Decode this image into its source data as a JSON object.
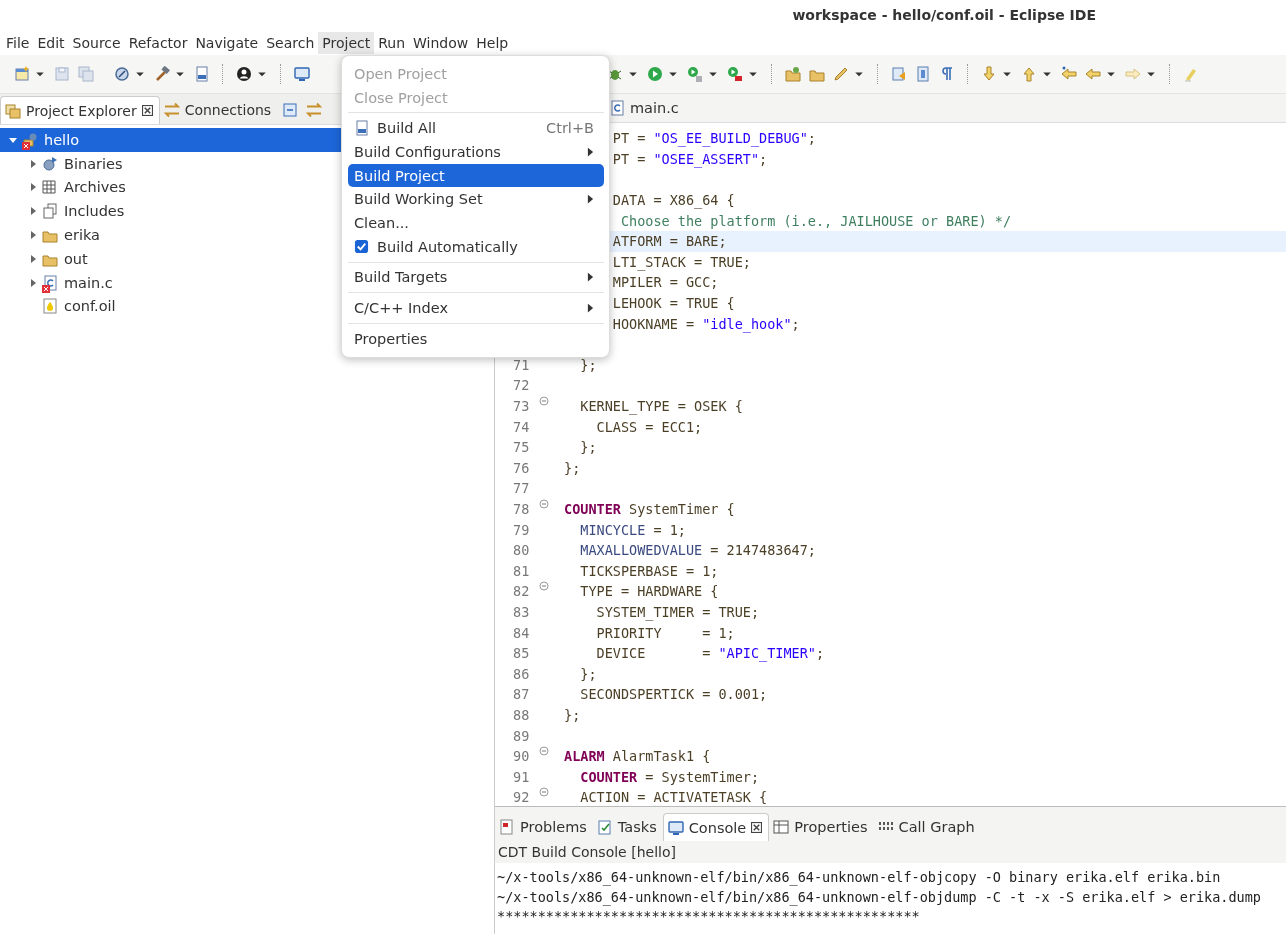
{
  "window": {
    "title": "workspace - hello/conf.oil - Eclipse IDE"
  },
  "menu_bar": [
    {
      "label": "File",
      "selected": false
    },
    {
      "label": "Edit",
      "selected": false
    },
    {
      "label": "Source",
      "selected": false
    },
    {
      "label": "Refactor",
      "selected": false
    },
    {
      "label": "Navigate",
      "selected": false
    },
    {
      "label": "Search",
      "selected": false
    },
    {
      "label": "Project",
      "selected": true
    },
    {
      "label": "Run",
      "selected": false
    },
    {
      "label": "Window",
      "selected": false
    },
    {
      "label": "Help",
      "selected": false
    }
  ],
  "project_menu": [
    {
      "kind": "item",
      "label": "Open Project",
      "disabled": true,
      "selected": false,
      "submenu": false
    },
    {
      "kind": "item",
      "label": "Close Project",
      "disabled": true,
      "selected": false,
      "submenu": false
    },
    {
      "kind": "separator"
    },
    {
      "kind": "icon-item",
      "label": "Build All",
      "shortcut": "Ctrl+B",
      "disabled": false,
      "selected": false,
      "submenu": false
    },
    {
      "kind": "item",
      "label": "Build Configurations",
      "disabled": false,
      "selected": false,
      "submenu": true
    },
    {
      "kind": "item",
      "label": "Build Project",
      "disabled": false,
      "selected": true,
      "submenu": false
    },
    {
      "kind": "item",
      "label": "Build Working Set",
      "disabled": false,
      "selected": false,
      "submenu": true
    },
    {
      "kind": "item",
      "label": "Clean...",
      "disabled": false,
      "selected": false,
      "submenu": false
    },
    {
      "kind": "check-item",
      "label": "Build Automatically",
      "checked": true,
      "disabled": false,
      "selected": false,
      "submenu": false
    },
    {
      "kind": "separator"
    },
    {
      "kind": "item",
      "label": "Build Targets",
      "disabled": false,
      "selected": false,
      "submenu": true
    },
    {
      "kind": "separator"
    },
    {
      "kind": "item",
      "label": "C/C++ Index",
      "disabled": false,
      "selected": false,
      "submenu": true
    },
    {
      "kind": "separator"
    },
    {
      "kind": "item",
      "label": "Properties",
      "disabled": false,
      "selected": false,
      "submenu": false
    }
  ],
  "left_panel": {
    "tabs": [
      {
        "label": "Project Explorer",
        "selected": true,
        "kind": "explorer"
      },
      {
        "label": "Connections",
        "selected": false,
        "kind": "connections"
      }
    ],
    "tree": [
      {
        "label": "hello",
        "kind": "project",
        "error": true,
        "expanded": true,
        "selected": true,
        "children": [
          {
            "label": "Binaries",
            "kind": "binaries",
            "error": false,
            "expanded": false,
            "selected": false
          },
          {
            "label": "Archives",
            "kind": "archives",
            "error": false,
            "expanded": false,
            "selected": false
          },
          {
            "label": "Includes",
            "kind": "includes",
            "error": false,
            "expanded": false,
            "selected": false
          },
          {
            "label": "erika",
            "kind": "folder",
            "error": false,
            "expanded": false,
            "selected": false
          },
          {
            "label": "out",
            "kind": "folder",
            "error": false,
            "expanded": false,
            "selected": false
          },
          {
            "label": "main.c",
            "kind": "c-file",
            "error": true,
            "expanded": false,
            "selected": false
          },
          {
            "label": "conf.oil",
            "kind": "oil-file",
            "error": false,
            "selected": false
          }
        ]
      }
    ]
  },
  "editor": {
    "tabs": [
      {
        "label": "main.c",
        "selected": false
      }
    ],
    "lines": [
      {
        "kind": "code",
        "parts": [
          {
            "kind": "plain",
            "text": "      PT = "
          },
          {
            "kind": "string",
            "text": "\"OS_EE_BUILD_DEBUG\""
          },
          {
            "kind": "plain",
            "text": ";"
          }
        ]
      },
      {
        "kind": "code",
        "parts": [
          {
            "kind": "plain",
            "text": "      PT = "
          },
          {
            "kind": "string",
            "text": "\"OSEE_ASSERT\""
          },
          {
            "kind": "plain",
            "text": ";"
          }
        ]
      },
      {
        "kind": "blank"
      },
      {
        "kind": "code",
        "parts": [
          {
            "kind": "plain",
            "text": "      DATA = X86_64 {"
          }
        ]
      },
      {
        "kind": "code",
        "parts": [
          {
            "kind": "comment",
            "text": "       Choose the platform (i.e., JAILHOUSE or BARE) */"
          }
        ]
      },
      {
        "kind": "code",
        "current": true,
        "parts": [
          {
            "kind": "plain",
            "text": "      ATFORM = BARE;"
          }
        ]
      },
      {
        "kind": "code",
        "parts": [
          {
            "kind": "plain",
            "text": "      LTI_STACK = TRUE;"
          }
        ]
      },
      {
        "kind": "code",
        "parts": [
          {
            "kind": "plain",
            "text": "      MPILER = GCC;"
          }
        ]
      },
      {
        "kind": "code",
        "parts": [
          {
            "kind": "plain",
            "text": "      LEHOOK = TRUE {"
          }
        ]
      },
      {
        "kind": "code",
        "parts": [
          {
            "kind": "plain",
            "text": "      HOOKNAME = "
          },
          {
            "kind": "string",
            "text": "\"idle_hook\""
          },
          {
            "kind": "plain",
            "text": ";"
          }
        ]
      },
      {
        "kind": "blank"
      },
      {
        "n": "71",
        "parts": [
          {
            "kind": "plain",
            "text": "  };"
          }
        ]
      },
      {
        "n": "72",
        "kind": "blank"
      },
      {
        "n": "73",
        "fold": true,
        "parts": [
          {
            "kind": "plain",
            "text": "  KERNEL_TYPE = OSEK {"
          }
        ]
      },
      {
        "n": "74",
        "parts": [
          {
            "kind": "plain",
            "text": "    CLASS = ECC1;"
          }
        ]
      },
      {
        "n": "75",
        "parts": [
          {
            "kind": "plain",
            "text": "  };"
          }
        ]
      },
      {
        "n": "76",
        "parts": [
          {
            "kind": "plain",
            "text": "};"
          }
        ]
      },
      {
        "n": "77",
        "kind": "blank"
      },
      {
        "n": "78",
        "fold": true,
        "parts": [
          {
            "kind": "keyword",
            "text": "COUNTER"
          },
          {
            "kind": "plain",
            "text": " SystemTimer {"
          }
        ]
      },
      {
        "n": "79",
        "parts": [
          {
            "kind": "attr",
            "text": "  MINCYCLE"
          },
          {
            "kind": "plain",
            "text": " = 1;"
          }
        ]
      },
      {
        "n": "80",
        "parts": [
          {
            "kind": "attr",
            "text": "  MAXALLOWEDVALUE"
          },
          {
            "kind": "plain",
            "text": " = 2147483647;"
          }
        ]
      },
      {
        "n": "81",
        "parts": [
          {
            "kind": "plain",
            "text": "  TICKSPERBASE = 1;"
          }
        ]
      },
      {
        "n": "82",
        "fold": true,
        "parts": [
          {
            "kind": "plain",
            "text": "  TYPE = HARDWARE {"
          }
        ]
      },
      {
        "n": "83",
        "parts": [
          {
            "kind": "plain",
            "text": "    SYSTEM_TIMER = TRUE;"
          }
        ]
      },
      {
        "n": "84",
        "parts": [
          {
            "kind": "plain",
            "text": "    PRIORITY     = 1;"
          }
        ]
      },
      {
        "n": "85",
        "parts": [
          {
            "kind": "plain",
            "text": "    DEVICE       = "
          },
          {
            "kind": "string",
            "text": "\"APIC_TIMER\""
          },
          {
            "kind": "plain",
            "text": ";"
          }
        ]
      },
      {
        "n": "86",
        "parts": [
          {
            "kind": "plain",
            "text": "  };"
          }
        ]
      },
      {
        "n": "87",
        "parts": [
          {
            "kind": "plain",
            "text": "  SECONDSPERTICK = 0.001;"
          }
        ]
      },
      {
        "n": "88",
        "parts": [
          {
            "kind": "plain",
            "text": "};"
          }
        ]
      },
      {
        "n": "89",
        "kind": "blank"
      },
      {
        "n": "90",
        "fold": true,
        "parts": [
          {
            "kind": "keyword",
            "text": "ALARM"
          },
          {
            "kind": "plain",
            "text": " AlarmTask1 {"
          }
        ]
      },
      {
        "n": "91",
        "parts": [
          {
            "kind": "keyword",
            "text": "  COUNTER"
          },
          {
            "kind": "plain",
            "text": " = SystemTimer;"
          }
        ]
      },
      {
        "n": "92",
        "fold": true,
        "parts": [
          {
            "kind": "plain",
            "text": "  ACTION = ACTIVATETASK {"
          }
        ]
      }
    ]
  },
  "bottom_panel": {
    "tabs": [
      {
        "label": "Problems",
        "kind": "problems",
        "selected": false
      },
      {
        "label": "Tasks",
        "kind": "tasks",
        "selected": false
      },
      {
        "label": "Console",
        "kind": "console",
        "selected": true
      },
      {
        "label": "Properties",
        "kind": "properties",
        "selected": false
      },
      {
        "label": "Call Graph",
        "kind": "call-graph",
        "selected": false
      }
    ],
    "console_title": "CDT Build Console [hello]",
    "console_lines": [
      "~/x-tools/x86_64-unknown-elf/bin/x86_64-unknown-elf-objcopy -O binary erika.elf erika.bin",
      "~/x-tools/x86_64-unknown-elf/bin/x86_64-unknown-elf-objdump -C -t -x -S erika.elf > erika.dump",
      "****************************************************"
    ]
  }
}
